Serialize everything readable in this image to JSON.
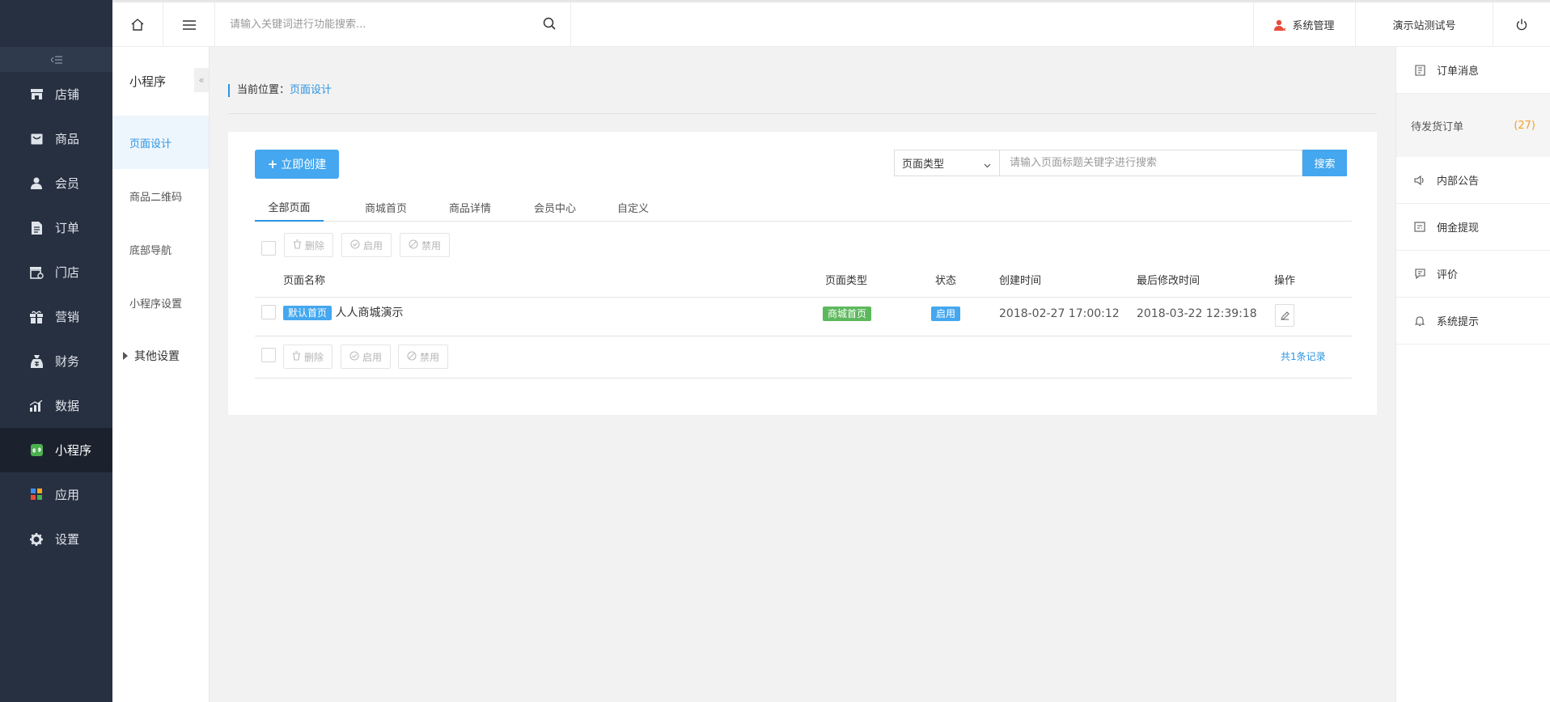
{
  "topbar": {
    "search_placeholder": "请输入关键词进行功能搜索...",
    "system_admin": "系统管理",
    "account": "演示站测试号"
  },
  "leftnav": {
    "items": [
      {
        "label": "店铺",
        "icon": "shop-icon"
      },
      {
        "label": "商品",
        "icon": "goods-icon"
      },
      {
        "label": "会员",
        "icon": "member-icon"
      },
      {
        "label": "订单",
        "icon": "order-icon"
      },
      {
        "label": "门店",
        "icon": "store-icon"
      },
      {
        "label": "营销",
        "icon": "gift-icon"
      },
      {
        "label": "财务",
        "icon": "finance-icon"
      },
      {
        "label": "数据",
        "icon": "chart-icon"
      },
      {
        "label": "小程序",
        "icon": "miniprogram-icon",
        "active": true
      },
      {
        "label": "应用",
        "icon": "apps-icon"
      },
      {
        "label": "设置",
        "icon": "gear-icon"
      }
    ]
  },
  "subnav": {
    "title": "小程序",
    "items": [
      "页面设计",
      "商品二维码",
      "底部导航",
      "小程序设置"
    ],
    "group": "其他设置"
  },
  "rightpanel": {
    "order_msg": "订单消息",
    "pending_label": "待发货订单",
    "pending_count": "(27)",
    "notice": "内部公告",
    "commission": "佣金提现",
    "review": "评价",
    "system_tip": "系统提示"
  },
  "breadcrumb": {
    "prefix": "当前位置：",
    "current": "页面设计"
  },
  "toolbar": {
    "create_label": "立即创建",
    "type_select": "页面类型",
    "keyword_placeholder": "请输入页面标题关键字进行搜索",
    "search_label": "搜索"
  },
  "tabs": [
    "全部页面",
    "商城首页",
    "商品详情",
    "会员中心",
    "自定义"
  ],
  "bulk": {
    "delete": "删除",
    "enable": "启用",
    "disable": "禁用"
  },
  "table": {
    "headers": [
      "页面名称",
      "页面类型",
      "状态",
      "创建时间",
      "最后修改时间",
      "操作"
    ],
    "rows": [
      {
        "default_badge": "默认首页",
        "name": "人人商城演示",
        "type": "商城首页",
        "status": "启用",
        "created": "2018-02-27 17:00:12",
        "modified": "2018-03-22 12:39:18"
      }
    ],
    "total": "共1条记录"
  },
  "colors": {
    "sidebar": "#273040",
    "accent": "#44a7ef",
    "green": "#5cb85c",
    "pending": "#f0a128"
  }
}
